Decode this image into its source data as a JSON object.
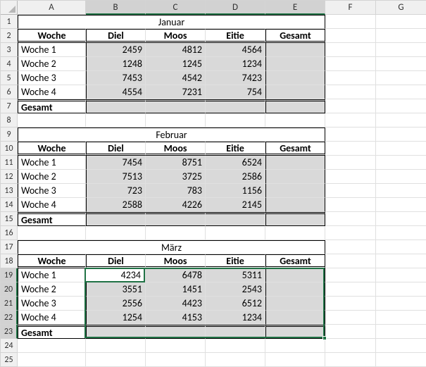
{
  "columns": [
    "A",
    "B",
    "C",
    "D",
    "E",
    "F",
    "G"
  ],
  "row_count": 25,
  "selected_cols": [
    "B",
    "C",
    "D",
    "E"
  ],
  "selected_rows": [
    19,
    20,
    21,
    22,
    23
  ],
  "active_cell": {
    "col": "B",
    "row": 19,
    "value": "4234"
  },
  "headers": {
    "woche": "Woche",
    "diel": "Diel",
    "moos": "Moos",
    "eitie": "Eitie",
    "gesamt": "Gesamt"
  },
  "labels": {
    "gesamt_row": "Gesamt",
    "w1": "Woche 1",
    "w2": "Woche 2",
    "w3": "Woche 3",
    "w4": "Woche 4"
  },
  "months": {
    "jan": {
      "title": "Januar",
      "rows": [
        {
          "label": "Woche 1",
          "diel": 2459,
          "moos": 4812,
          "eitie": 4564
        },
        {
          "label": "Woche 2",
          "diel": 1248,
          "moos": 1245,
          "eitie": 1234
        },
        {
          "label": "Woche 3",
          "diel": 7453,
          "moos": 4542,
          "eitie": 7423
        },
        {
          "label": "Woche 4",
          "diel": 4554,
          "moos": 7231,
          "eitie": 754
        }
      ]
    },
    "feb": {
      "title": "Februar",
      "rows": [
        {
          "label": "Woche 1",
          "diel": 7454,
          "moos": 8751,
          "eitie": 6524
        },
        {
          "label": "Woche 2",
          "diel": 7513,
          "moos": 3725,
          "eitie": 2586
        },
        {
          "label": "Woche 3",
          "diel": 723,
          "moos": 783,
          "eitie": 1156
        },
        {
          "label": "Woche 4",
          "diel": 2588,
          "moos": 4226,
          "eitie": 2145
        }
      ]
    },
    "mar": {
      "title": "März",
      "rows": [
        {
          "label": "Woche 1",
          "diel": 4234,
          "moos": 6478,
          "eitie": 5311
        },
        {
          "label": "Woche 2",
          "diel": 3551,
          "moos": 1451,
          "eitie": 2543
        },
        {
          "label": "Woche 3",
          "diel": 2556,
          "moos": 4423,
          "eitie": 6512
        },
        {
          "label": "Woche 4",
          "diel": 1254,
          "moos": 4153,
          "eitie": 1234
        }
      ]
    }
  }
}
